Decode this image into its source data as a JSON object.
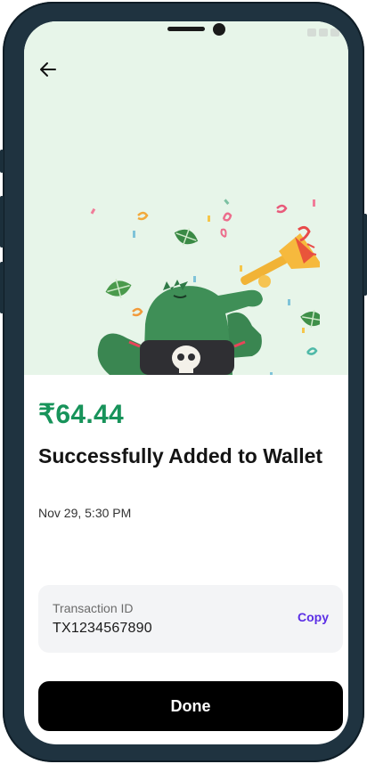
{
  "success": {
    "amount": "₹64.44",
    "title": "Successfully Added to Wallet",
    "datetime": "Nov 29, 5:30 PM"
  },
  "transaction": {
    "label": "Transaction ID",
    "id": "TX1234567890",
    "copy_label": "Copy"
  },
  "actions": {
    "done_label": "Done"
  },
  "icons": {
    "back": "arrow-left-icon",
    "illustration": "crocodile-trumpet-celebration"
  },
  "colors": {
    "amount": "#17935a",
    "hero_background": "#e7f5e9",
    "copy_link": "#5b2ee5",
    "done_button": "#000000",
    "card_background": "#f3f4f6"
  }
}
